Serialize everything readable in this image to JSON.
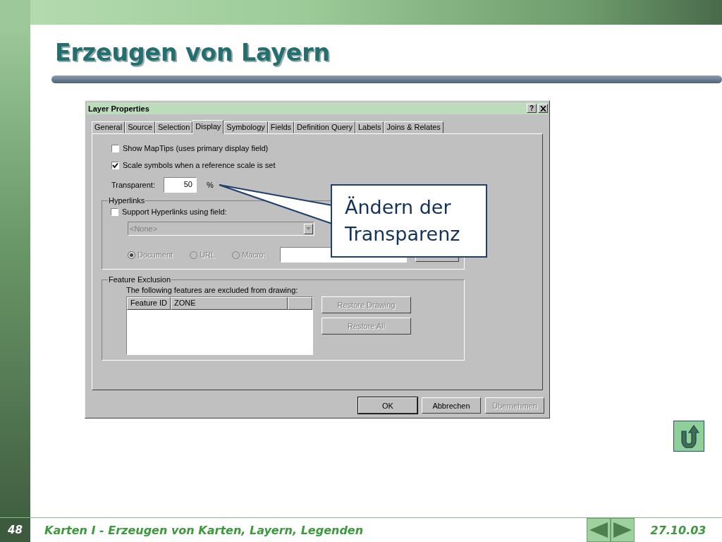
{
  "slide": {
    "title": "Erzeugen von Layern",
    "page_number": "48",
    "footer": "Karten I - Erzeugen von Karten, Layern, Legenden",
    "date": "27.10.03"
  },
  "dialog": {
    "title": "Layer Properties",
    "help_button": "?",
    "tabs": [
      {
        "label": "General",
        "selected": false
      },
      {
        "label": "Source",
        "selected": false
      },
      {
        "label": "Selection",
        "selected": false
      },
      {
        "label": "Display",
        "selected": true
      },
      {
        "label": "Symbology",
        "selected": false
      },
      {
        "label": "Fields",
        "selected": false
      },
      {
        "label": "Definition Query",
        "selected": false
      },
      {
        "label": "Labels",
        "selected": false
      },
      {
        "label": "Joins & Relates",
        "selected": false
      }
    ],
    "options": [
      {
        "label": "Show MapTips (uses primary display field)",
        "checked": false
      },
      {
        "label": "Scale symbols when a reference scale is set",
        "checked": true
      }
    ],
    "transparent": {
      "label": "Transparent:",
      "value": "50",
      "unit": "%"
    },
    "hyperlinks": {
      "title": "Hyperlinks",
      "checkbox": {
        "label": "Support Hyperlinks using field:",
        "checked": false
      },
      "field": {
        "value": "<None>",
        "disabled": true
      },
      "radios": [
        {
          "label": "Document",
          "selected": true,
          "disabled": true
        },
        {
          "label": "URL",
          "selected": false,
          "disabled": true
        },
        {
          "label": "Macro:",
          "selected": false,
          "disabled": true
        }
      ]
    },
    "feature_exclusion": {
      "title": "Feature Exclusion",
      "text": "The following features are excluded from drawing:",
      "columns": [
        "Feature ID",
        "ZONE"
      ],
      "buttons": [
        {
          "label": "Restore Drawing",
          "disabled": true
        },
        {
          "label": "Restore All",
          "disabled": true
        }
      ]
    },
    "buttons": [
      {
        "label": "OK",
        "disabled": false
      },
      {
        "label": "Abbrechen",
        "disabled": false
      },
      {
        "label": "Übernehmen",
        "disabled": true
      }
    ]
  },
  "callout": {
    "text": "Ändern der Transparenz"
  }
}
